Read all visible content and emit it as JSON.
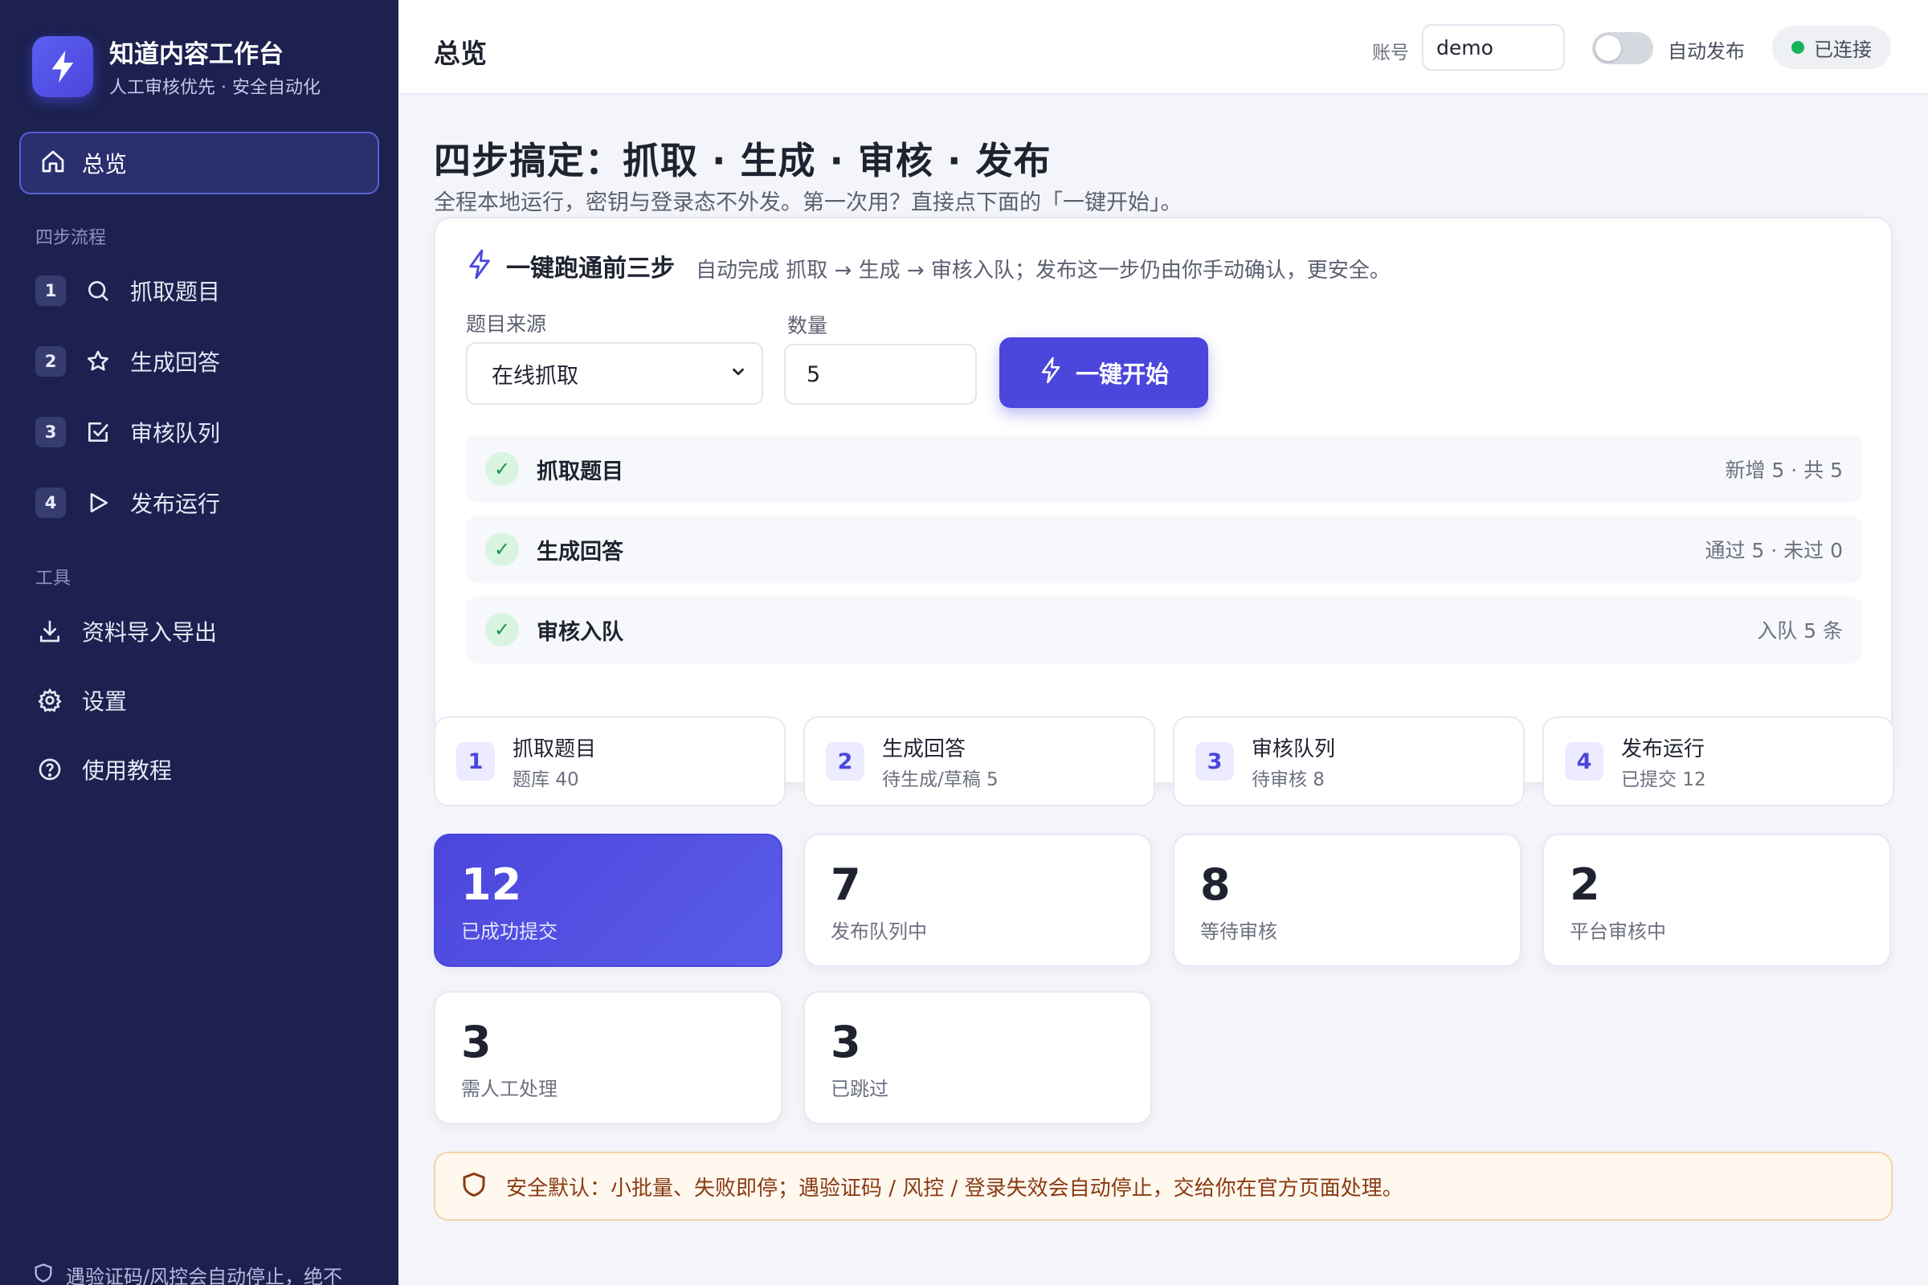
{
  "brand": {
    "title": "知道内容工作台",
    "subtitle": "人工审核优先 · 安全自动化"
  },
  "sidebar": {
    "active": {
      "label": "总览",
      "icon": "home-icon"
    },
    "section_steps": "四步流程",
    "steps": [
      {
        "num": "1",
        "label": "抓取题目",
        "icon": "search-icon"
      },
      {
        "num": "2",
        "label": "生成回答",
        "icon": "star-icon"
      },
      {
        "num": "3",
        "label": "审核队列",
        "icon": "checkbox-icon"
      },
      {
        "num": "4",
        "label": "发布运行",
        "icon": "play-icon"
      }
    ],
    "section_tools": "工具",
    "tools": [
      {
        "label": "资料导入导出",
        "icon": "download-icon"
      },
      {
        "label": "设置",
        "icon": "gear-icon"
      },
      {
        "label": "使用教程",
        "icon": "help-icon"
      }
    ],
    "footer": "遇验证码/风控会自动停止，绝不"
  },
  "topbar": {
    "title": "总览",
    "account_label": "账号",
    "account_value": "demo",
    "auto_publish_label": "自动发布",
    "auto_publish_on": false,
    "connection": "已连接",
    "connection_color": "#17b45c"
  },
  "hero": {
    "title": "四步搞定：抓取 · 生成 · 审核 · 发布",
    "subtitle": "全程本地运行，密钥与登录态不外发。第一次用？直接点下面的「一键开始」。"
  },
  "quick": {
    "title": "一键跑通前三步",
    "desc": "自动完成 抓取 → 生成 → 审核入队；发布这一步仍由你手动确认，更安全。",
    "source_label": "题目来源",
    "source_value": "在线抓取",
    "count_label": "数量",
    "count_value": "5",
    "start_label": "一键开始",
    "accent": "#4b46dc",
    "results": [
      {
        "name": "抓取题目",
        "stat": "新增 5 · 共 5"
      },
      {
        "name": "生成回答",
        "stat": "通过 5 · 未过 0"
      },
      {
        "name": "审核入队",
        "stat": "入队 5 条"
      }
    ]
  },
  "step_cards": [
    {
      "num": "1",
      "title": "抓取题目",
      "sub": "题库 40"
    },
    {
      "num": "2",
      "title": "生成回答",
      "sub": "待生成/草稿 5"
    },
    {
      "num": "3",
      "title": "审核队列",
      "sub": "待审核 8"
    },
    {
      "num": "4",
      "title": "发布运行",
      "sub": "已提交 12"
    }
  ],
  "stats": [
    {
      "value": "12",
      "label": "已成功提交"
    },
    {
      "value": "7",
      "label": "发布队列中"
    },
    {
      "value": "8",
      "label": "等待审核"
    },
    {
      "value": "2",
      "label": "平台审核中"
    },
    {
      "value": "3",
      "label": "需人工处理"
    },
    {
      "value": "3",
      "label": "已跳过"
    }
  ],
  "safety": "安全默认：小批量、失败即停；遇验证码 / 风控 / 登录失效会自动停止，交给你在官方页面处理。"
}
